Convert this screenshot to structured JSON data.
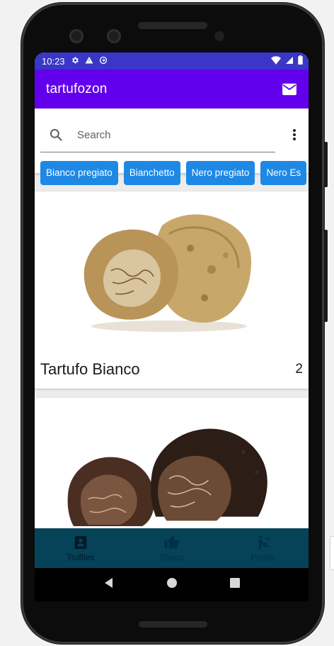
{
  "status_bar": {
    "time": "10:23",
    "icons": [
      "gear-icon",
      "warning-icon",
      "sync-icon",
      "wifi-icon",
      "signal-icon",
      "battery-icon"
    ]
  },
  "app_bar": {
    "title": "tartufozon",
    "mail_icon": "mail-icon"
  },
  "search": {
    "placeholder": "Search",
    "search_icon": "search-icon",
    "menu_icon": "more-vert-icon"
  },
  "chips": [
    {
      "label": "Bianco pregiato"
    },
    {
      "label": "Bianchetto"
    },
    {
      "label": "Nero pregiato"
    },
    {
      "label": "Nero Es"
    }
  ],
  "cards": [
    {
      "name": "Tartufo Bianco",
      "count": "2",
      "image": "white-truffle-image"
    },
    {
      "name": "",
      "count": "",
      "image": "black-truffle-image"
    }
  ],
  "bottom_nav": [
    {
      "label": "Truffles",
      "icon": "contact-card-icon",
      "active": true
    },
    {
      "label": "Shops",
      "icon": "thumbs-up-icon",
      "active": false
    },
    {
      "label": "Profile",
      "icon": "person-shower-icon",
      "active": false
    }
  ],
  "colors": {
    "app_bar": "#6200ee",
    "status_bar": "#3a36c8",
    "chip": "#1e88e5",
    "bottom_nav": "#064258"
  }
}
